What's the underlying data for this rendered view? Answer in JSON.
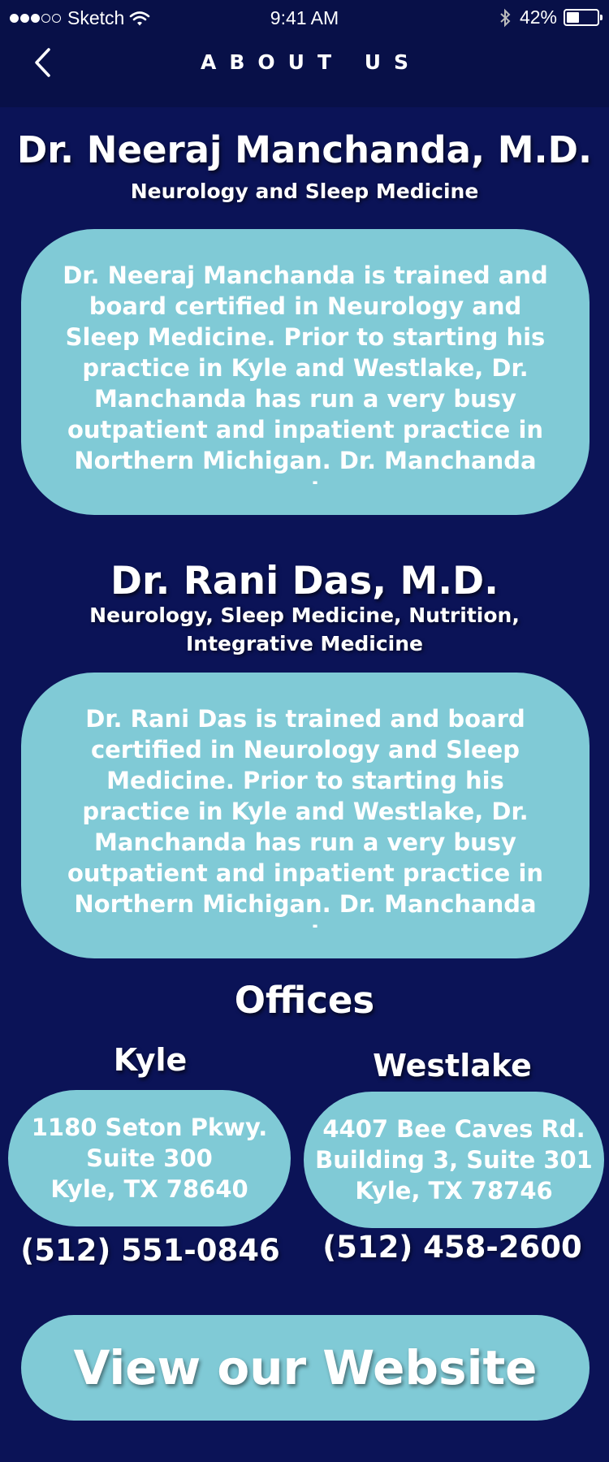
{
  "status_bar": {
    "carrier": "Sketch",
    "time": "9:41 AM",
    "battery_percent": "42%",
    "battery_level": 0.42,
    "signal_icon": "signal-dots-icon",
    "wifi_icon": "wifi-icon",
    "bluetooth_icon": "bluetooth-icon",
    "battery_icon": "battery-icon"
  },
  "nav": {
    "title": "ABOUT US",
    "back_icon": "chevron-left-icon"
  },
  "doctors": [
    {
      "name": "Dr. Neeraj Manchanda, M.D.",
      "specialty": "Neurology and Sleep Medicine",
      "bio": "Dr. Neeraj Manchanda is trained and board certified in Neurology and Sleep Medicine. Prior to starting his practice in Kyle and Westlake, Dr. Manchanda has run a very busy outpatient and inpatient practice in Northern Michigan. Dr. Manchanda served as a"
    },
    {
      "name": "Dr. Rani Das, M.D.",
      "specialty_line1": "Neurology, Sleep Medicine, Nutrition,",
      "specialty_line2": "Integrative Medicine",
      "bio": "Dr. Rani Das is trained and board certified in Neurology and Sleep Medicine. Prior to starting his practice in Kyle and Westlake, Dr. Manchanda has run a very busy outpatient and inpatient practice in Northern Michigan. Dr. Manchanda served as a"
    }
  ],
  "offices": {
    "title": "Offices",
    "locations": [
      {
        "name": "Kyle",
        "address_line1": "1180 Seton Pkwy.",
        "address_line2": "Suite 300",
        "address_line3": "Kyle, TX 78640",
        "phone": "(512) 551-0846"
      },
      {
        "name": "Westlake",
        "address_line1": "4407 Bee Caves Rd.",
        "address_line2": "Building 3, Suite 301",
        "address_line3": "Kyle, TX 78746",
        "phone": "(512) 458-2600"
      }
    ]
  },
  "website_button": "View our Website",
  "colors": {
    "background": "#0b1357",
    "header": "#081048",
    "card": "#80cad6",
    "text": "#ffffff"
  }
}
